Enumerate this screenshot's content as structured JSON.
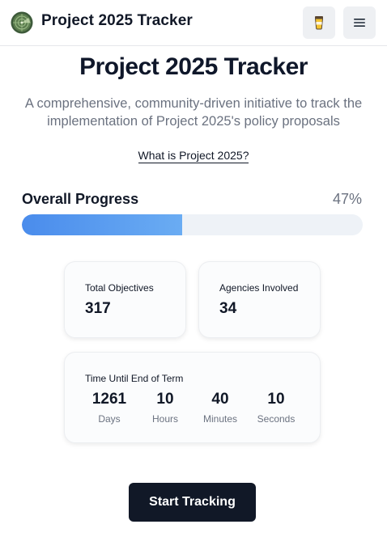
{
  "header": {
    "app_title": "Project 2025 Tracker",
    "logo_icon": "radar-globe-icon",
    "coffee_icon": "coffee-cup-icon",
    "menu_icon": "hamburger-menu-icon"
  },
  "hero": {
    "title": "Project 2025 Tracker",
    "subtitle": "A comprehensive, community-driven initiative to track the implementation of Project 2025's policy proposals",
    "link_label": "What is Project 2025?"
  },
  "progress": {
    "label": "Overall Progress",
    "value_text": "47%",
    "value": 0.47,
    "fill_colors": [
      "#4a8cec",
      "#6aacf3"
    ]
  },
  "stats": {
    "total_objectives": {
      "label": "Total Objectives",
      "value": "317"
    },
    "agencies_involved": {
      "label": "Agencies Involved",
      "value": "34"
    }
  },
  "timer": {
    "label": "Time Until End of Term",
    "days": {
      "value": "1261",
      "label": "Days"
    },
    "hours": {
      "value": "10",
      "label": "Hours"
    },
    "minutes": {
      "value": "40",
      "label": "Minutes"
    },
    "seconds": {
      "value": "10",
      "label": "Seconds"
    }
  },
  "cta": {
    "label": "Start Tracking"
  },
  "colors": {
    "text_primary": "#111827",
    "text_muted": "#6b7280",
    "button_dark": "#111827",
    "progress_track": "#eef2f7"
  }
}
